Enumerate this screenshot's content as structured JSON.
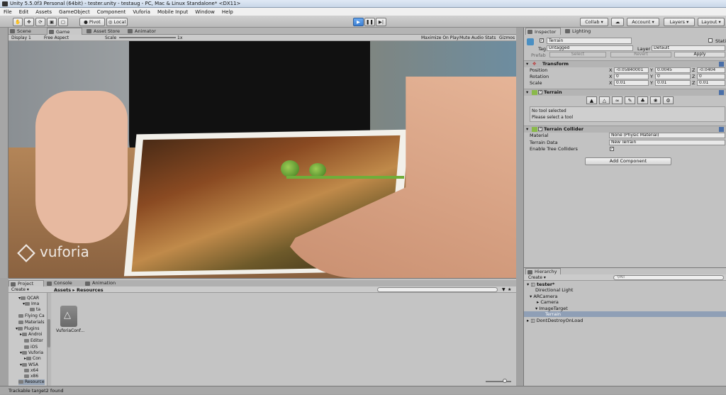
{
  "window": {
    "title": "Unity 5.5.0f3 Personal (64bit) - tester.unity - testaug - PC, Mac & Linux Standalone* <DX11>"
  },
  "menu": [
    "File",
    "Edit",
    "Assets",
    "GameObject",
    "Component",
    "Vuforia",
    "Mobile Input",
    "Window",
    "Help"
  ],
  "toolbar": {
    "pivot": "Pivot",
    "local": "Local",
    "collab": "Collab",
    "account": "Account",
    "layers": "Layers",
    "layout": "Layout"
  },
  "tabs_top": {
    "scene": "Scene",
    "game": "Game",
    "asset_store": "Asset Store",
    "animator": "Animator"
  },
  "gamebar": {
    "display": "Display 1",
    "aspect": "Free Aspect",
    "scale": "Scale",
    "scale_value": "1x",
    "maximize": "Maximize On Play",
    "mute": "Mute Audio",
    "stats": "Stats",
    "gizmos": "Gizmos"
  },
  "watermark": "vuforia",
  "tabs_bottom": {
    "project": "Project",
    "console": "Console",
    "animation": "Animation"
  },
  "project": {
    "create": "Create",
    "breadcrumb": "Assets ▸ Resources",
    "tree": [
      "QCAR",
      "Ima",
      "ta",
      "Flying Ca",
      "Materials",
      "Plugins",
      "Androi",
      "Editor",
      "iOS",
      "Vuforia",
      "Con",
      "WSA",
      "x64",
      "x86",
      "Resource"
    ],
    "asset_label": "VuforiaConf..."
  },
  "status": "Trackable target2 found",
  "inspector": {
    "tab": "Inspector",
    "tab2": "Lighting",
    "object_name": "Terrain",
    "static": "Static",
    "tag_label": "Tag",
    "tag_value": "Untagged",
    "layer_label": "Layer",
    "layer_value": "Default",
    "prefab": "Prefab",
    "select": "Select",
    "revert": "Revert",
    "apply": "Apply",
    "transform": {
      "title": "Transform",
      "position": "Position",
      "rotation": "Rotation",
      "scale": "Scale",
      "pos": [
        "-0.05840001",
        "0.0045",
        "-0.0404"
      ],
      "rot": [
        "0",
        "0",
        "0"
      ],
      "scl": [
        "0.01",
        "0.01",
        "0.01"
      ]
    },
    "terrain": {
      "title": "Terrain",
      "no_tool": "No tool selected",
      "select_tool": "Please select a tool"
    },
    "collider": {
      "title": "Terrain Collider",
      "material": "Material",
      "material_value": "None (Physic Material)",
      "data": "Terrain Data",
      "data_value": "New Terrain",
      "trees": "Enable Tree Colliders"
    },
    "add_component": "Add Component"
  },
  "axes": {
    "x": "X",
    "y": "Y",
    "z": "Z"
  },
  "hierarchy": {
    "tab": "Hierarchy",
    "create": "Create",
    "search": "All",
    "scene": "tester*",
    "items": [
      "Directional Light",
      "ARCamera",
      "Camera",
      "ImageTarget",
      "Terrain",
      "DontDestroyOnLoad"
    ]
  }
}
